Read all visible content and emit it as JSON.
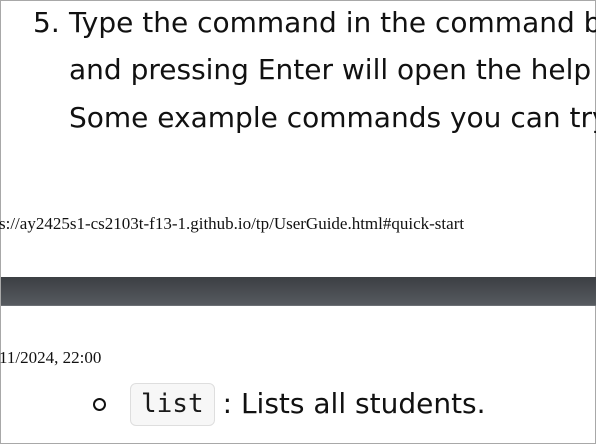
{
  "quickstart": {
    "step_number": "5.",
    "lines": [
      "Type the command in the command box",
      "and pressing Enter will open the help",
      "Some example commands you can try:"
    ]
  },
  "print_footer": {
    "url": "s://ay2425s1-cs2103t-f13-1.github.io/tp/UserGuide.html#quick-start"
  },
  "print_header": {
    "datetime": "11/2024, 22:00"
  },
  "example_commands": [
    {
      "command": "list",
      "description": ": Lists all students."
    }
  ]
}
